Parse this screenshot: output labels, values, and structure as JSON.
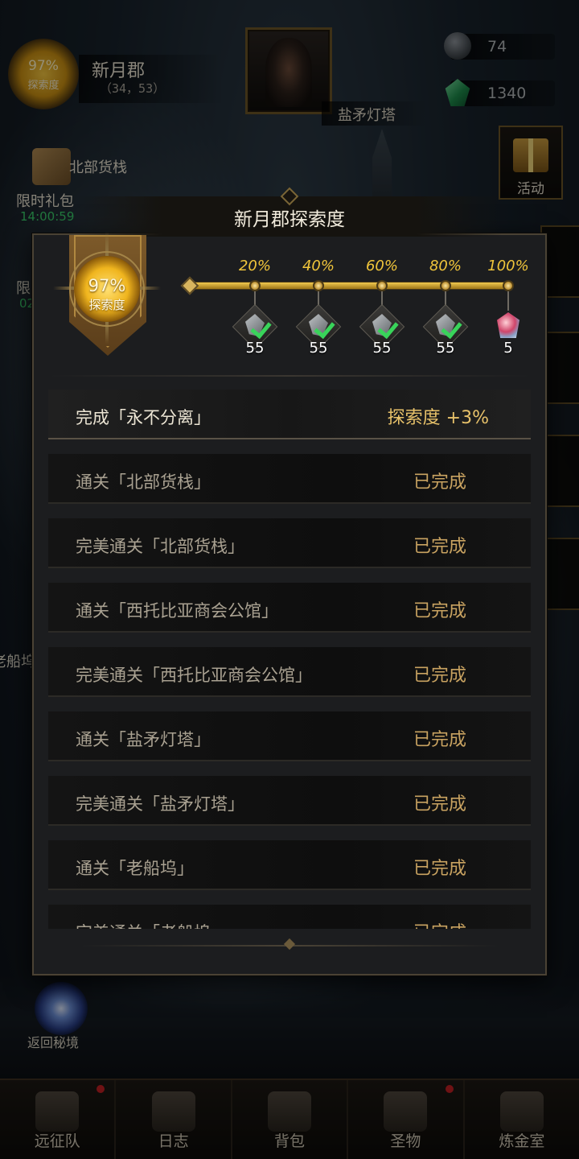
{
  "hud": {
    "exploration_pct": "97%",
    "exploration_label": "探索度",
    "region_name": "新月郡",
    "region_coord": "（34，53）",
    "location_name": "盐矛灯塔",
    "stone_count": "74",
    "gem_count": "1340",
    "gift_place": "北部货栈",
    "gift_label": "限时礼包",
    "gift_timer": "14:00:59",
    "event_label": "活动",
    "side_label_1": "限",
    "side_timer_1": "02",
    "side_place_2": "老船坞",
    "return_label": "返回秘境"
  },
  "modal": {
    "title": "新月郡探索度",
    "dial_pct": "97%",
    "dial_label": "探索度",
    "milestones": [
      {
        "pct": "20%",
        "qty": "55",
        "claimed": true
      },
      {
        "pct": "40%",
        "qty": "55",
        "claimed": true
      },
      {
        "pct": "60%",
        "qty": "55",
        "claimed": true
      },
      {
        "pct": "80%",
        "qty": "55",
        "claimed": true
      },
      {
        "pct": "100%",
        "qty": "5",
        "claimed": false
      }
    ],
    "tasks": [
      {
        "text": "完成「永不分离」",
        "status": "探索度 +3%"
      },
      {
        "text": "通关「北部货栈」",
        "status": "已完成"
      },
      {
        "text": "完美通关「北部货栈」",
        "status": "已完成"
      },
      {
        "text": "通关「西托比亚商会公馆」",
        "status": "已完成"
      },
      {
        "text": "完美通关「西托比亚商会公馆」",
        "status": "已完成"
      },
      {
        "text": "通关「盐矛灯塔」",
        "status": "已完成"
      },
      {
        "text": "完美通关「盐矛灯塔」",
        "status": "已完成"
      },
      {
        "text": "通关「老船坞」",
        "status": "已完成"
      },
      {
        "text": "完美通关「老船坞」",
        "status": "已完成"
      }
    ]
  },
  "nav": {
    "items": [
      {
        "label": "远征队",
        "icon": "helmet-icon",
        "badge": true
      },
      {
        "label": "日志",
        "icon": "scroll-icon",
        "badge": false
      },
      {
        "label": "背包",
        "icon": "bag-icon",
        "badge": false
      },
      {
        "label": "圣物",
        "icon": "chalice-icon",
        "badge": true
      },
      {
        "label": "炼金室",
        "icon": "alchemy-icon",
        "badge": false
      }
    ]
  },
  "colors": {
    "accent_gold": "#f0c53b",
    "status_done": "#c9a361",
    "check_green": "#39d45a",
    "timer_green": "#3ccf6b"
  }
}
